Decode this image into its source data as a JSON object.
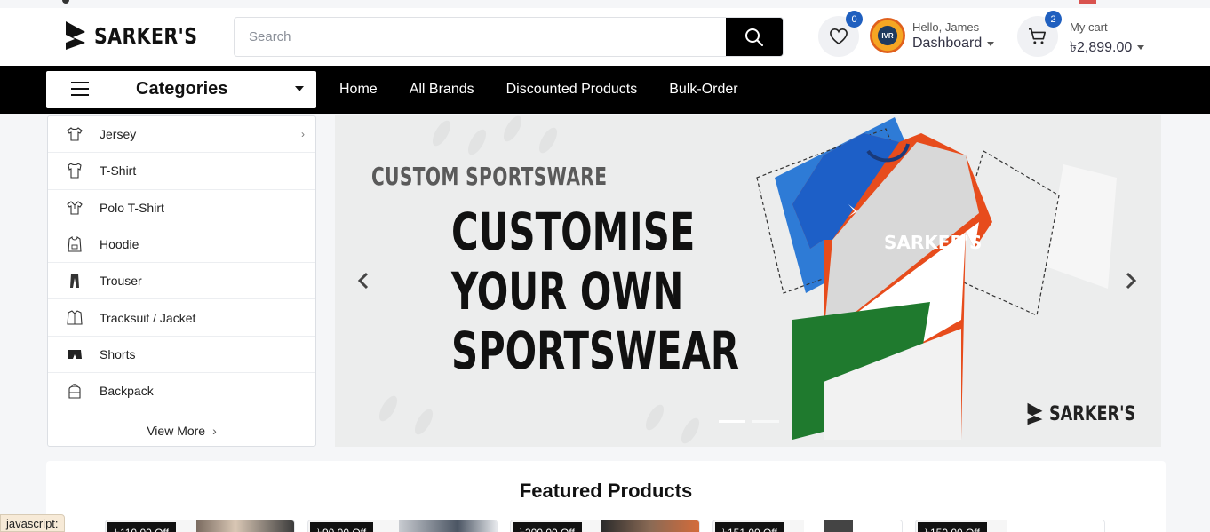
{
  "header": {
    "logo_text": "SARKER'S",
    "search_placeholder": "Search",
    "wishlist_count": "0",
    "greeting": "Hello, James",
    "dashboard_label": "Dashboard",
    "avatar_text": "IVR",
    "cart_count": "2",
    "cart_label": "My cart",
    "cart_total": "৳2,899.00"
  },
  "nav": {
    "categories_label": "Categories",
    "links": [
      "Home",
      "All Brands",
      "Discounted Products",
      "Bulk-Order"
    ]
  },
  "categories": {
    "items": [
      {
        "label": "Jersey",
        "icon": "jersey-icon",
        "has_arrow": true
      },
      {
        "label": "T-Shirt",
        "icon": "tshirt-icon"
      },
      {
        "label": "Polo T-Shirt",
        "icon": "polo-tshirt-icon"
      },
      {
        "label": "Hoodie",
        "icon": "hoodie-icon"
      },
      {
        "label": "Trouser",
        "icon": "trouser-icon"
      },
      {
        "label": "Tracksuit / Jacket",
        "icon": "jacket-icon"
      },
      {
        "label": "Shorts",
        "icon": "shorts-icon"
      },
      {
        "label": "Backpack",
        "icon": "backpack-icon"
      }
    ],
    "view_more": "View More"
  },
  "banner": {
    "subtitle": "CUSTOM SPORTSWARE",
    "line1": "CUSTOMISE",
    "line2": "YOUR OWN",
    "line3": "SPORTSWEAR",
    "jersey_text": "SARKER'S",
    "brand": "SARKER'S",
    "active_slide": 1,
    "slide_count": 2
  },
  "featured": {
    "title": "Featured Products",
    "cards": [
      {
        "discount": "৳110.00 Off"
      },
      {
        "discount": "৳90.00 Off"
      },
      {
        "discount": "৳300.00 Off"
      },
      {
        "discount": "৳151.00 Off"
      },
      {
        "discount": "৳150.00 Off"
      }
    ]
  },
  "status_bar": "javascript:",
  "colors": {
    "accent": "#000000",
    "badge": "#1f5fbf",
    "background": "#f5f6f8"
  }
}
